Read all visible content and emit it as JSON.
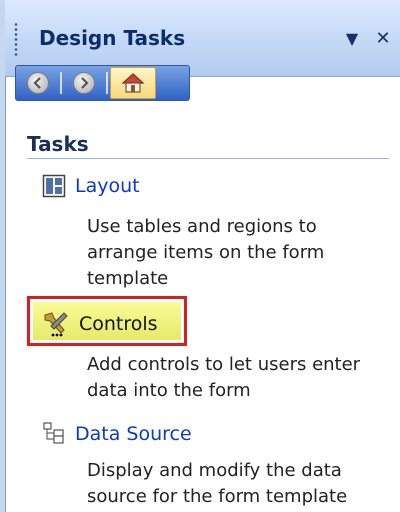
{
  "pane": {
    "title": "Design Tasks",
    "dropdown_symbol": "▼",
    "close_symbol": "✕"
  },
  "nav": {
    "back_icon": "back-arrow-icon",
    "forward_icon": "forward-arrow-icon",
    "home_icon": "home-icon"
  },
  "section": {
    "heading": "Tasks"
  },
  "tasks": [
    {
      "label": "Layout",
      "icon": "layout-icon",
      "description": "Use tables and regions to arrange items on the form template"
    },
    {
      "label": "Controls",
      "icon": "controls-icon",
      "description": "Add controls to let users enter data into the form"
    },
    {
      "label": "Data Source",
      "icon": "data-source-icon",
      "description": "Display and modify the data source for the form template"
    }
  ],
  "colors": {
    "link": "#0b39c8",
    "highlight_border": "#d81f1f",
    "highlight_fill": "#eef07a"
  }
}
